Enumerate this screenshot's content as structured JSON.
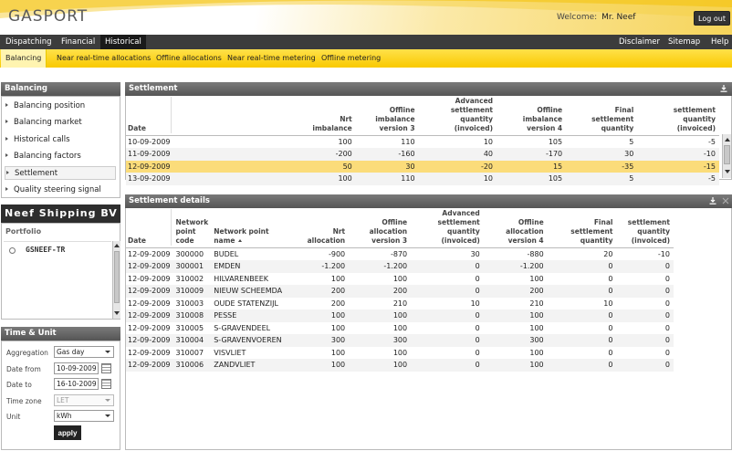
{
  "app": {
    "logo": "GASPORT",
    "welcome_label": "Welcome:",
    "user": "Mr. Neef",
    "logout_label": "Log out"
  },
  "main_nav": {
    "left": [
      "Dispatching",
      "Financial",
      "Historical"
    ],
    "active": "Historical",
    "right": [
      "Disclaimer",
      "Sitemap",
      "Help"
    ]
  },
  "sub_nav": {
    "items": [
      "Balancing",
      "Near real-time allocations",
      "Offline allocations",
      "Near real-time metering",
      "Offline metering"
    ],
    "active": "Balancing"
  },
  "balancing_menu": {
    "title": "Balancing",
    "items": [
      "Balancing position",
      "Balancing market",
      "Historical calls",
      "Balancing factors",
      "Settlement",
      "Quality steering signal"
    ],
    "active": "Settlement"
  },
  "company": {
    "name": "Neef Shipping BV",
    "portfolio_label": "Portfolio",
    "portfolio_item": "GSNEEF-TR"
  },
  "time_unit": {
    "title": "Time & Unit",
    "aggregation_label": "Aggregation",
    "aggregation_value": "Gas day",
    "date_from_label": "Date from",
    "date_from_value": "10-09-2009",
    "date_to_label": "Date to",
    "date_to_value": "16-10-2009",
    "time_zone_label": "Time zone",
    "time_zone_value": "LET",
    "unit_label": "Unit",
    "unit_value": "kWh",
    "apply_label": "apply"
  },
  "settlement": {
    "title": "Settlement",
    "headers": [
      [
        "Date"
      ],
      [
        "Nrt",
        "imbalance"
      ],
      [
        "Offline",
        "imbalance",
        "version 3"
      ],
      [
        "Advanced",
        "settlement",
        "quantity",
        "(invoiced)"
      ],
      [
        "Offline",
        "imbalance",
        "version 4"
      ],
      [
        "Final",
        "settlement",
        "quantity"
      ],
      [
        "settlement",
        "quantity",
        "(invoiced)"
      ]
    ],
    "rows": [
      [
        "10-09-2009",
        "100",
        "110",
        "10",
        "105",
        "5",
        "-5"
      ],
      [
        "11-09-2009",
        "-200",
        "-160",
        "40",
        "-170",
        "30",
        "-10"
      ],
      [
        "12-09-2009",
        "50",
        "30",
        "-20",
        "15",
        "-35",
        "-15"
      ],
      [
        "13-09-2009",
        "100",
        "110",
        "10",
        "105",
        "5",
        "-5"
      ]
    ],
    "highlight_row": 2
  },
  "details": {
    "title": "Settlement details",
    "headers": [
      [
        "Date"
      ],
      [
        "Network",
        "point",
        "code"
      ],
      [
        "Network point",
        "name"
      ],
      [
        "Nrt",
        "allocation"
      ],
      [
        "Offline",
        "allocation",
        "version 3"
      ],
      [
        "Advanced",
        "settlement",
        "quantity",
        "(invoiced)"
      ],
      [
        "Offline",
        "allocation",
        "version 4"
      ],
      [
        "Final",
        "settlement",
        "quantity"
      ],
      [
        "settlement",
        "quantity",
        "(invoiced)"
      ]
    ],
    "rows": [
      [
        "12-09-2009",
        "300000",
        "BUDEL",
        "-900",
        "-870",
        "30",
        "-880",
        "20",
        "-10"
      ],
      [
        "12-09-2009",
        "300001",
        "EMDEN",
        "-1.200",
        "-1.200",
        "0",
        "-1.200",
        "0",
        "0"
      ],
      [
        "12-09-2009",
        "310002",
        "HILVARENBEEK",
        "100",
        "100",
        "0",
        "100",
        "0",
        "0"
      ],
      [
        "12-09-2009",
        "310009",
        "NIEUW SCHEEMDA",
        "200",
        "200",
        "0",
        "200",
        "0",
        "0"
      ],
      [
        "12-09-2009",
        "310003",
        "OUDE STATENZIJL",
        "200",
        "210",
        "10",
        "210",
        "10",
        "0"
      ],
      [
        "12-09-2009",
        "310008",
        "PESSE",
        "100",
        "100",
        "0",
        "100",
        "0",
        "0"
      ],
      [
        "12-09-2009",
        "310005",
        "S-GRAVENDEEL",
        "100",
        "100",
        "0",
        "100",
        "0",
        "0"
      ],
      [
        "12-09-2009",
        "310004",
        "S-GRAVENVOEREN",
        "300",
        "300",
        "0",
        "300",
        "0",
        "0"
      ],
      [
        "12-09-2009",
        "310007",
        "VISVLIET",
        "100",
        "100",
        "0",
        "100",
        "0",
        "0"
      ],
      [
        "12-09-2009",
        "310006",
        "ZANDVLIET",
        "100",
        "100",
        "0",
        "100",
        "0",
        "0"
      ]
    ]
  },
  "icons": {
    "download": "download-icon",
    "close": "close-icon",
    "calendar": "calendar-icon",
    "sort": "sort-ascending-icon"
  }
}
